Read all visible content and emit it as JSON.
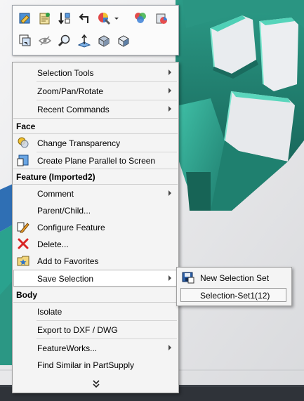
{
  "toolbar": {
    "row1": [
      "previous-view-icon",
      "section-view-icon",
      "insert-feature-icon",
      "undo-arrow-icon",
      "appearance-icon",
      "appearance-dropdown-icon",
      "apply-scene-icon",
      "view-settings-icon"
    ],
    "row2": [
      "zoom-to-selection-icon",
      "hide-show-icon",
      "zoom-to-area-icon",
      "normal-to-icon",
      "display-style-icon",
      "view-orientation-icon"
    ]
  },
  "menu": {
    "general": [
      {
        "label": "Selection Tools",
        "submenu": true
      },
      {
        "label": "Zoom/Pan/Rotate",
        "submenu": true
      },
      {
        "label": "Recent Commands",
        "submenu": true
      }
    ],
    "face_header": "Face",
    "face": [
      {
        "label": "Change Transparency",
        "icon": "transparency-icon"
      },
      {
        "label": "Create Plane Parallel to Screen",
        "icon": "plane-icon"
      }
    ],
    "feature_header": "Feature (Imported2)",
    "feature": [
      {
        "label": "Comment",
        "submenu": true
      },
      {
        "label": "Parent/Child..."
      },
      {
        "label": "Configure Feature",
        "icon": "configure-icon"
      },
      {
        "label": "Delete...",
        "icon": "delete-icon"
      },
      {
        "label": "Add to Favorites",
        "icon": "favorites-icon"
      },
      {
        "label": "Save Selection",
        "submenu": true,
        "highlighted": true
      }
    ],
    "body_header": "Body",
    "body": [
      {
        "label": "Isolate"
      },
      {
        "label": "Export to DXF / DWG"
      },
      {
        "label": "FeatureWorks...",
        "submenu": true
      },
      {
        "label": "Find Similar in PartSupply"
      }
    ],
    "more_icon": "chevron-double-down-icon"
  },
  "submenu": {
    "items": [
      {
        "label": "New Selection Set",
        "icon": "selection-set-icon"
      },
      {
        "label": "Selection-Set1(12)"
      }
    ]
  }
}
